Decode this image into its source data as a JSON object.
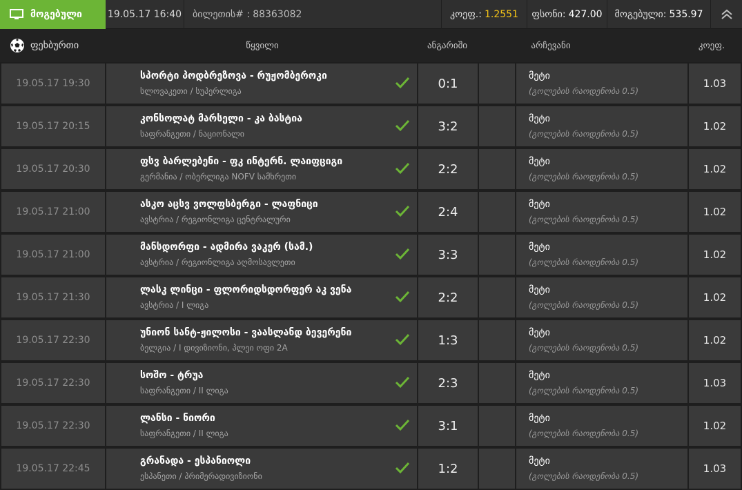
{
  "header": {
    "status_label": "მოგებული",
    "date": "19.05.17 16:40",
    "ticket_label": "ბილეთის# :",
    "ticket_number": "88363082",
    "odds_label": "კოეფ.:",
    "odds_value": "1.2551",
    "stake_label": "ფსონი:",
    "stake_value": "427.00",
    "win_label": "მოგებული:",
    "win_value": "535.97",
    "colors": {
      "status_bg": "#6cb536",
      "odds": "#f5c518",
      "check": "#6cb536"
    }
  },
  "columns": {
    "sport": "ფეხბურთი",
    "event": "წყვილი",
    "score": "ანგარიში",
    "pick": "არჩევანი",
    "odd": "კოეფ."
  },
  "icons": {
    "status": "monitor-icon",
    "collapse": "chevron-up-icon",
    "sport": "soccer-ball-icon",
    "result": "check-icon"
  },
  "rows": [
    {
      "datetime": "19.05.17 19:30",
      "event": "სპორტი პოდბრეზოვა - რუჟომბეროკი",
      "league": "სლოვაკეთი / სუპერლიგა",
      "score": "0:1",
      "pick": "მეტი",
      "pick_detail": "(გოლების რაოდენობა 0.5)",
      "odd": "1.03"
    },
    {
      "datetime": "19.05.17 20:15",
      "event": "კონსოლატ მარსელი - კა ბასტია",
      "league": "საფრანგეთი / ნაციონალი",
      "score": "3:2",
      "pick": "მეტი",
      "pick_detail": "(გოლების რაოდენობა 0.5)",
      "odd": "1.02"
    },
    {
      "datetime": "19.05.17 20:30",
      "event": "ფსვ ბარლებენი - ფკ ინტერნ. ლაიფციგი",
      "league": "გერმანია / ობერლიგა NOFV სამხრეთი",
      "score": "2:2",
      "pick": "მეტი",
      "pick_detail": "(გოლების რაოდენობა 0.5)",
      "odd": "1.02"
    },
    {
      "datetime": "19.05.17 21:00",
      "event": "ასკო აცსვ ვოლფსბერგი - ლაფნიცი",
      "league": "ავსტრია / რეგიონლიგა ცენტრალური",
      "score": "2:4",
      "pick": "მეტი",
      "pick_detail": "(გოლების რაოდენობა 0.5)",
      "odd": "1.02"
    },
    {
      "datetime": "19.05.17 21:00",
      "event": "მანსდორფი - ადმირა ვაკერ (სამ.)",
      "league": "ავსტრია / რეგიონლიგა აღმოსავლეთი",
      "score": "3:3",
      "pick": "მეტი",
      "pick_detail": "(გოლების რაოდენობა 0.5)",
      "odd": "1.02"
    },
    {
      "datetime": "19.05.17 21:30",
      "event": "ლასკ ლინცი - ფლორიდსდორფერ აკ ვენა",
      "league": "ავსტრია / I ლიგა",
      "score": "2:2",
      "pick": "მეტი",
      "pick_detail": "(გოლების რაოდენობა 0.5)",
      "odd": "1.02"
    },
    {
      "datetime": "19.05.17 22:30",
      "event": "უნიონ სანტ-ჟილოსი - ვაასლანდ ბევერენი",
      "league": "ბელგია / I დივიზიონი, პლეი ოფი 2A",
      "score": "1:3",
      "pick": "მეტი",
      "pick_detail": "(გოლების რაოდენობა 0.5)",
      "odd": "1.02"
    },
    {
      "datetime": "19.05.17 22:30",
      "event": "სოშო - ტრუა",
      "league": "საფრანგეთი / II ლიგა",
      "score": "2:3",
      "pick": "მეტი",
      "pick_detail": "(გოლების რაოდენობა 0.5)",
      "odd": "1.03"
    },
    {
      "datetime": "19.05.17 22:30",
      "event": "ლანსი - ნიორი",
      "league": "საფრანგეთი / II ლიგა",
      "score": "3:1",
      "pick": "მეტი",
      "pick_detail": "(გოლების რაოდენობა 0.5)",
      "odd": "1.02"
    },
    {
      "datetime": "19.05.17 22:45",
      "event": "გრანადა - ესპანიოლი",
      "league": "ესპანეთი / პრიმერადივიზიონი",
      "score": "1:2",
      "pick": "მეტი",
      "pick_detail": "(გოლების რაოდენობა 0.5)",
      "odd": "1.03"
    }
  ]
}
